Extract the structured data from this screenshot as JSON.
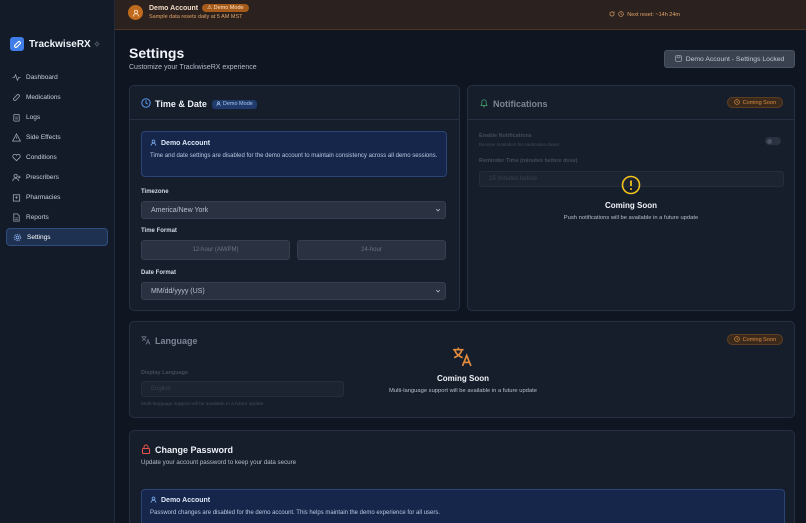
{
  "banner": {
    "title": "Demo Account",
    "badge": "Demo Mode",
    "subtitle": "Sample data resets daily at 5 AM MST",
    "reset_text": "Next reset: ~14h 24m"
  },
  "sidebar": {
    "brand": "TrackwiseRX",
    "items": [
      {
        "label": "Dashboard",
        "icon": "activity-icon"
      },
      {
        "label": "Medications",
        "icon": "pill-icon"
      },
      {
        "label": "Logs",
        "icon": "clipboard-icon"
      },
      {
        "label": "Side Effects",
        "icon": "alert-triangle-icon"
      },
      {
        "label": "Conditions",
        "icon": "heart-icon"
      },
      {
        "label": "Prescribers",
        "icon": "user-plus-icon"
      },
      {
        "label": "Pharmacies",
        "icon": "building-icon"
      },
      {
        "label": "Reports",
        "icon": "file-icon"
      },
      {
        "label": "Settings",
        "icon": "gear-icon",
        "active": true
      }
    ]
  },
  "header": {
    "title": "Settings",
    "subtitle": "Customize your TrackwiseRX experience",
    "locked_button": "Demo Account - Settings Locked"
  },
  "time_date": {
    "title": "Time & Date",
    "tag": "Demo Mode",
    "info_title": "Demo Account",
    "info_body": "Time and date settings are disabled for the demo account to maintain consistency across all demo sessions.",
    "timezone_label": "Timezone",
    "timezone_value": "America/New York",
    "time_format_label": "Time Format",
    "time_format_12": "12-hour (AM/PM)",
    "time_format_24": "24-hour",
    "date_format_label": "Date Format",
    "date_format_value": "MM/dd/yyyy (US)"
  },
  "notifications": {
    "title": "Notifications",
    "badge": "Coming Soon",
    "enable_label": "Enable Notifications",
    "enable_sub": "Receive reminders for medication doses",
    "reminder_label": "Reminder Time (minutes before dose)",
    "reminder_value": "15 minutes before",
    "soon_title": "Coming Soon",
    "soon_sub": "Push notifications will be available in a future update"
  },
  "language": {
    "title": "Language",
    "badge": "Coming Soon",
    "display_label": "Display Language",
    "display_value": "English",
    "display_note": "Multi-language support will be available in a future update",
    "soon_title": "Coming Soon",
    "soon_sub": "Multi-language support will be available in a future update"
  },
  "password": {
    "title": "Change Password",
    "subtitle": "Update your account password to keep your data secure",
    "info_title": "Demo Account",
    "info_body": "Password changes are disabled for the demo account. This helps maintain the demo experience for all users."
  },
  "colors": {
    "accent": "#3f7ee8",
    "warning": "#d88c42",
    "danger": "#e5534b",
    "background": "#0f1521"
  }
}
